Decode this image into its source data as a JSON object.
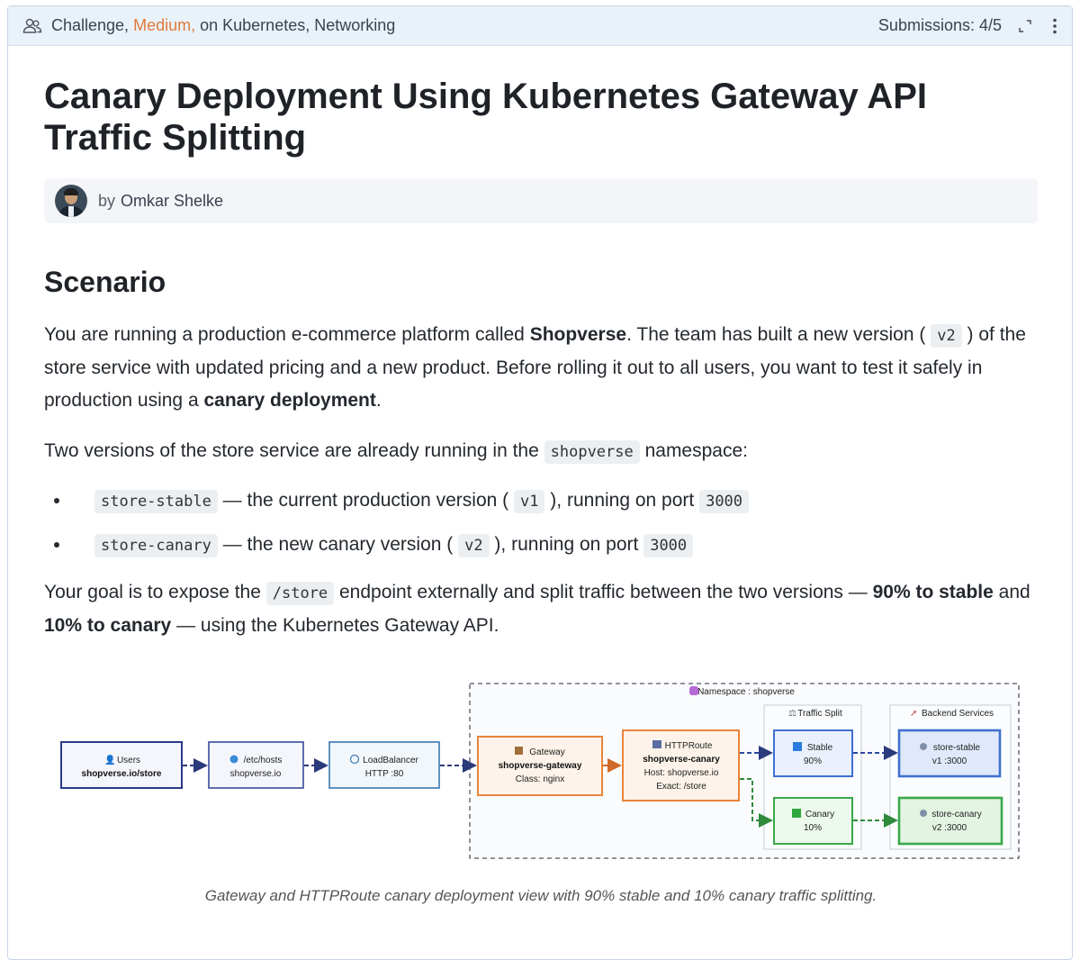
{
  "header": {
    "challenge": "Challenge,",
    "difficulty": "Medium,",
    "topics": "on Kubernetes, Networking",
    "submissions": "Submissions: 4/5",
    "icons": [
      "people-icon",
      "expand-icon",
      "kebab-menu-icon"
    ],
    "accent_color": "#e07b3a"
  },
  "title": "Canary Deployment Using Kubernetes Gateway API Traffic Splitting",
  "author": {
    "by": "by",
    "name": "Omkar Shelke"
  },
  "scenario": {
    "heading": "Scenario",
    "p1": {
      "t1": "You are running a production e-commerce platform called ",
      "b1": "Shopverse",
      "t2": ". The team has built a new version ( ",
      "c1": "v2",
      "t3": " ) of the store service with updated pricing and a new product. Before rolling it out to all users, you want to test it safely in production using a ",
      "b2": "canary deployment",
      "t4": "."
    },
    "p2": {
      "t1": "Two versions of the store service are already running in the ",
      "c1": "shopverse",
      "t2": " namespace:"
    },
    "bullets": [
      {
        "code": "store-stable",
        "t1": " — the current production version ( ",
        "ver": "v1",
        "t2": " ), running on port ",
        "port": "3000"
      },
      {
        "code": "store-canary",
        "t1": " — the new canary version ( ",
        "ver": "v2",
        "t2": " ), running on port ",
        "port": "3000"
      }
    ],
    "p3": {
      "t1": "Your goal is to expose the ",
      "c1": "/store",
      "t2": " endpoint externally and split traffic between the two versions — ",
      "b1": "90% to stable",
      "t3": " and ",
      "b2": "10% to canary",
      "t4": " — using the Kubernetes Gateway API."
    }
  },
  "diagram": {
    "namespace": "Namespace : shopverse",
    "traffic_split": "Traffic Split",
    "backend_services": "Backend Services",
    "users": {
      "title": "Users",
      "sub": "shopverse.io/store"
    },
    "hosts": {
      "title": "/etc/hosts",
      "sub": "shopverse.io"
    },
    "lb": {
      "title": "LoadBalancer",
      "sub": "HTTP :80"
    },
    "gateway": {
      "title": "Gateway",
      "name": "shopverse-gateway",
      "sub": "Class: nginx"
    },
    "route": {
      "title": "HTTPRoute",
      "name": "shopverse-canary",
      "host": "Host: shopverse.io",
      "match": "Exact: /store"
    },
    "stable": {
      "title": "Stable",
      "pct": "90%"
    },
    "canary": {
      "title": "Canary",
      "pct": "10%"
    },
    "svc_stable": {
      "title": "store-stable",
      "sub": "v1 :3000"
    },
    "svc_canary": {
      "title": "store-canary",
      "sub": "v2 :3000"
    },
    "colors": {
      "blue": "#3f6fd1",
      "orange": "#e8843a",
      "green": "#3aa84a",
      "navy": "#2b3a7a"
    }
  },
  "caption": "Gateway and HTTPRoute canary deployment view with 90% stable and 10% canary traffic splitting."
}
